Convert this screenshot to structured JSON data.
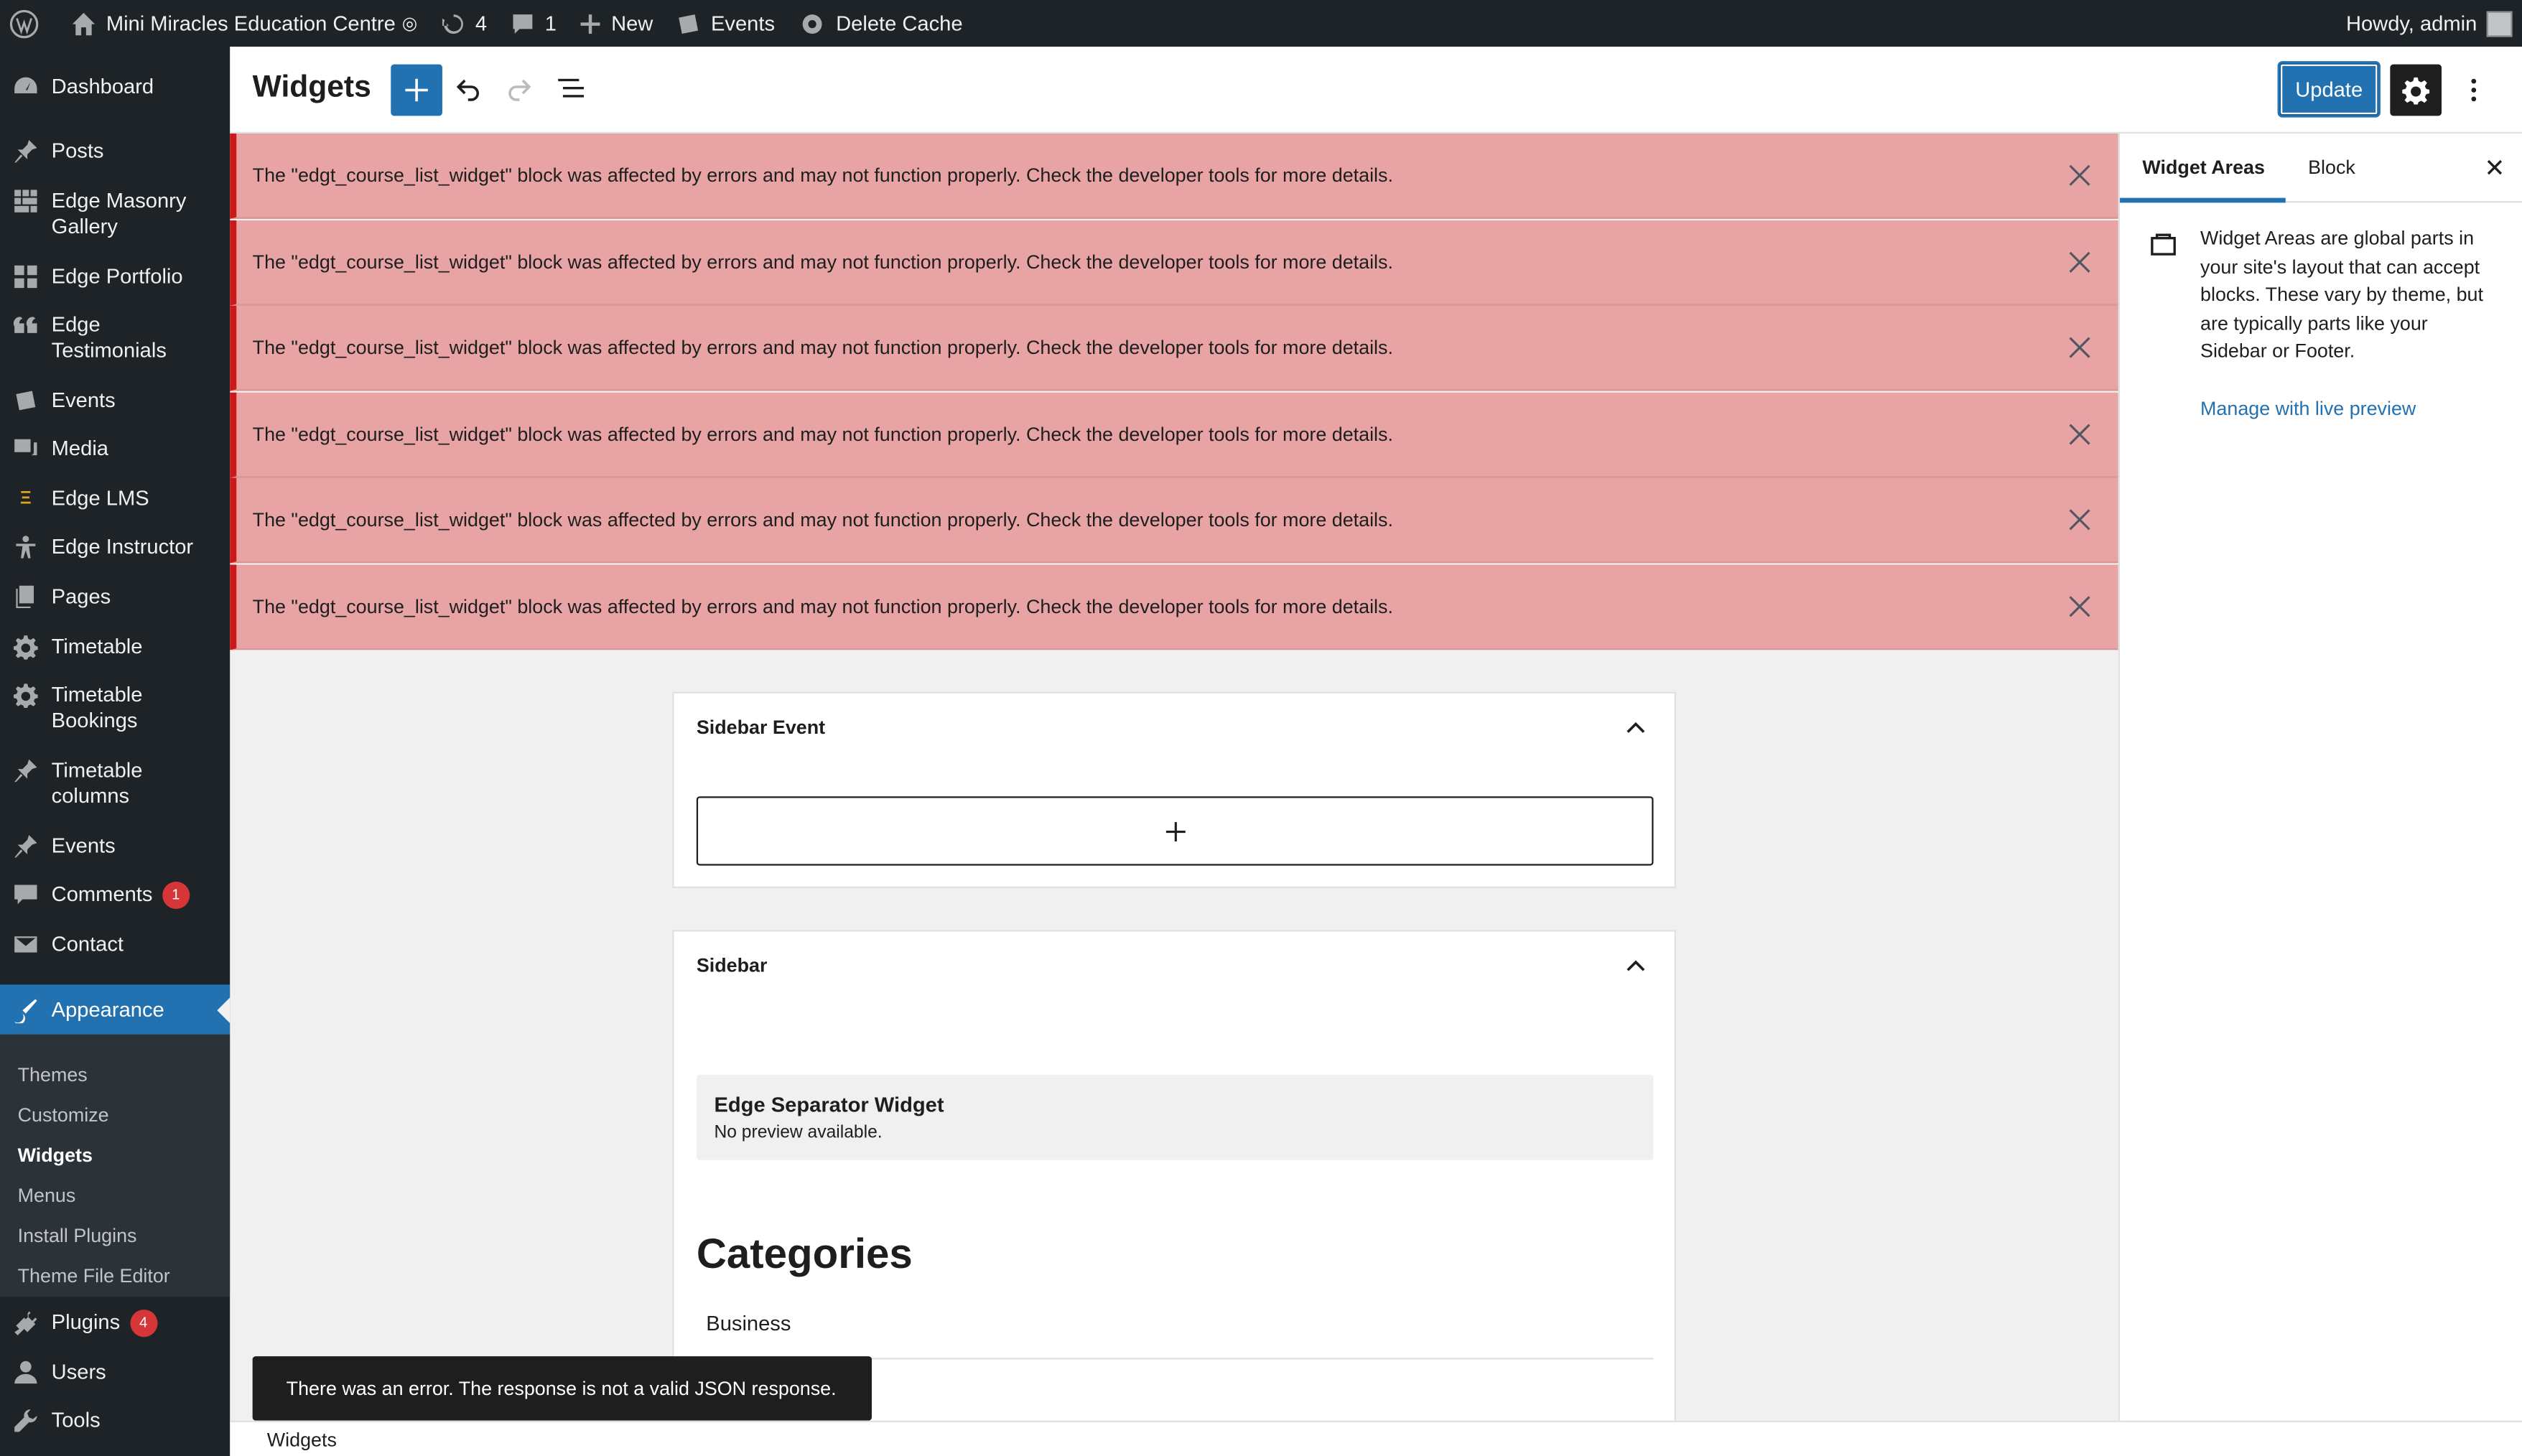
{
  "adminbar": {
    "site_name": "Mini Miracles Education Centre",
    "updates_count": "4",
    "comments_count": "1",
    "new_label": "New",
    "events_label": "Events",
    "delete_cache_label": "Delete Cache",
    "howdy": "Howdy, admin"
  },
  "menu": {
    "dashboard": "Dashboard",
    "posts": "Posts",
    "masonry": "Edge Masonry Gallery",
    "portfolio": "Edge Portfolio",
    "testimonials": "Edge Testimonials",
    "events": "Events",
    "media": "Media",
    "lms": "Edge LMS",
    "instructor": "Edge Instructor",
    "pages": "Pages",
    "timetable": "Timetable",
    "timetable_bookings": "Timetable Bookings",
    "timetable_columns": "Timetable columns",
    "events2": "Events",
    "comments": "Comments",
    "comments_badge": "1",
    "contact": "Contact",
    "appearance": "Appearance",
    "plugins": "Plugins",
    "plugins_badge": "4",
    "users": "Users",
    "tools": "Tools"
  },
  "submenu": {
    "themes": "Themes",
    "customize": "Customize",
    "widgets": "Widgets",
    "menus": "Menus",
    "install_plugins": "Install Plugins",
    "theme_file_editor": "Theme File Editor"
  },
  "header": {
    "title": "Widgets",
    "update_label": "Update"
  },
  "notices": [
    "The \"edgt_course_list_widget\" block was affected by errors and may not function properly. Check the developer tools for more details.",
    "The \"edgt_course_list_widget\" block was affected by errors and may not function properly. Check the developer tools for more details.",
    "The \"edgt_course_list_widget\" block was affected by errors and may not function properly. Check the developer tools for more details.",
    "The \"edgt_course_list_widget\" block was affected by errors and may not function properly. Check the developer tools for more details.",
    "The \"edgt_course_list_widget\" block was affected by errors and may not function properly. Check the developer tools for more details.",
    "The \"edgt_course_list_widget\" block was affected by errors and may not function properly. Check the developer tools for more details."
  ],
  "canvas": {
    "area1_title": "Sidebar Event",
    "area2_title": "Sidebar",
    "legacy_title": "Edge Separator Widget",
    "legacy_subtitle": "No preview available.",
    "categories_heading": "Categories",
    "category_item": "Business"
  },
  "settings": {
    "tab_widget_areas": "Widget Areas",
    "tab_block": "Block",
    "description": "Widget Areas are global parts in your site's layout that can accept blocks. These vary by theme, but are typically parts like your Sidebar or Footer.",
    "manage_link": "Manage with live preview"
  },
  "snackbar": {
    "message": "There was an error. The response is not a valid JSON response."
  },
  "footer": {
    "breadcrumb": "Widgets"
  },
  "colors": {
    "admin_dark": "#1d2327",
    "accent": "#2271b1",
    "notice_bg": "#e8a4a4",
    "notice_border": "#cc1818",
    "badge": "#d63638"
  }
}
